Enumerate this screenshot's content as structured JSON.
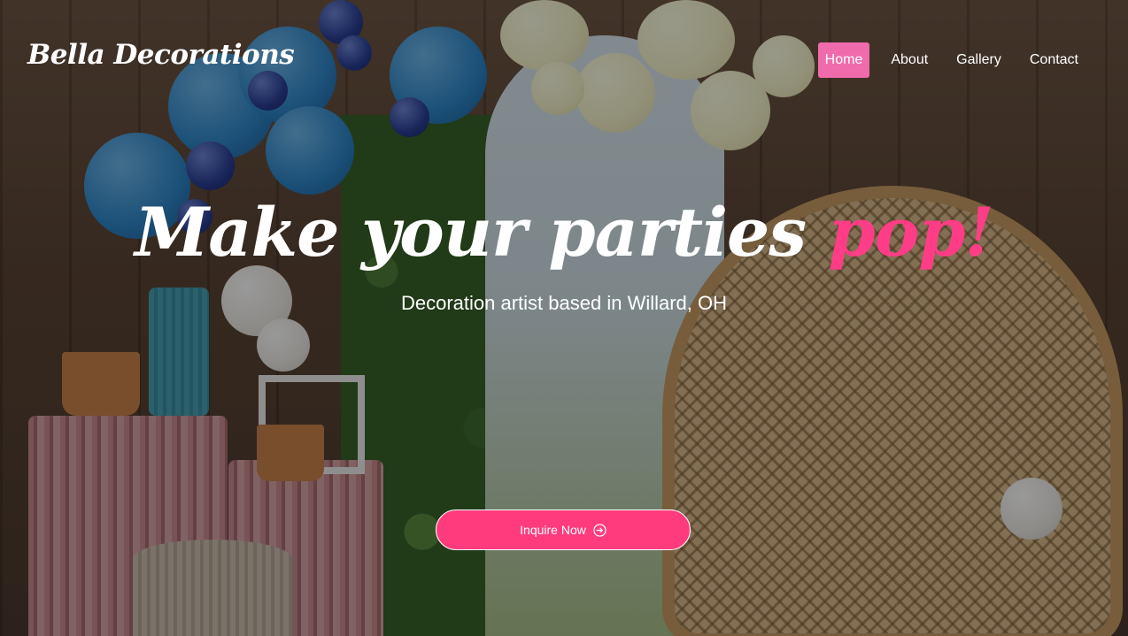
{
  "brand": {
    "name": "Bella Decorations"
  },
  "nav": {
    "items": [
      {
        "label": "Home",
        "active": true
      },
      {
        "label": "About",
        "active": false
      },
      {
        "label": "Gallery",
        "active": false
      },
      {
        "label": "Contact",
        "active": false
      }
    ]
  },
  "hero": {
    "headline_main": "Make your parties ",
    "headline_accent": "pop!",
    "subtitle": "Decoration artist based in Willard, OH",
    "cta_label": "Inquire Now",
    "cta_icon": "arrow-right-circle-icon"
  },
  "colors": {
    "accent_pink": "#ff3d86",
    "nav_active_bg": "#f06bac",
    "cta_bg": "#ff3b7d",
    "text": "#ffffff"
  }
}
